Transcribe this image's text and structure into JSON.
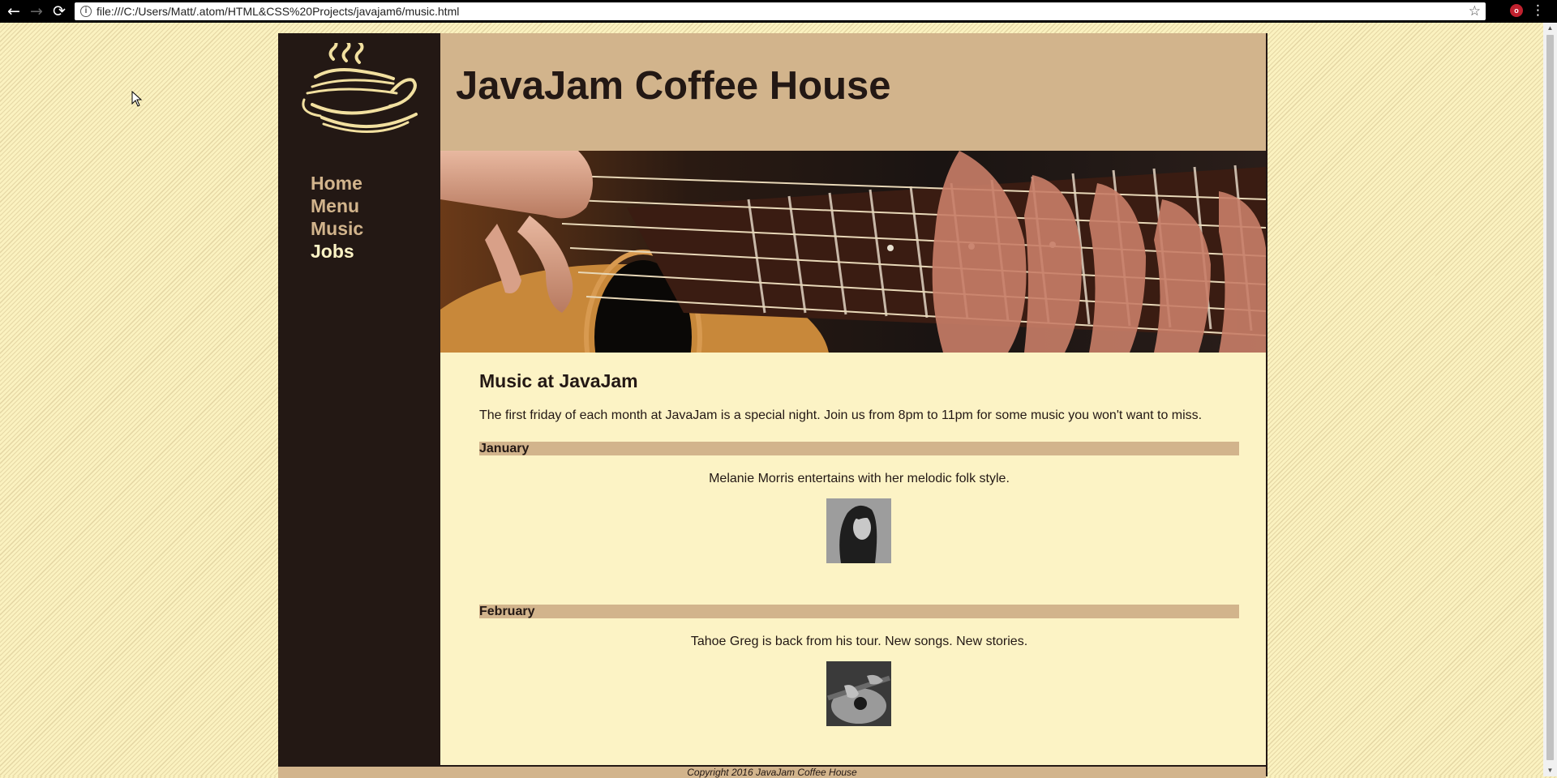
{
  "browser": {
    "url": "file:///C:/Users/Matt/.atom/HTML&CSS%20Projects/javajam6/music.html",
    "back_icon": "←",
    "forward_icon": "→",
    "reload_icon": "⟳",
    "info_icon": "i",
    "star_icon": "☆",
    "menu_icon": "⋮",
    "extension_badge": "o"
  },
  "header": {
    "title": "JavaJam Coffee House"
  },
  "nav": {
    "items": [
      {
        "label": "Home"
      },
      {
        "label": "Menu"
      },
      {
        "label": "Music"
      },
      {
        "label": "Jobs"
      }
    ]
  },
  "main": {
    "heading": "Music at JavaJam",
    "intro": "The first friday of each month at JavaJam is a special night. Join us from 8pm to 11pm for some music you won't want to miss.",
    "events": [
      {
        "month": "January",
        "description": "Melanie Morris entertains with her melodic folk style."
      },
      {
        "month": "February",
        "description": "Tahoe Greg is back from his tour. New songs. New stories."
      }
    ]
  },
  "footer": {
    "text": "Copyright 2016 JavaJam Coffee House"
  },
  "colors": {
    "dark_brown": "#231814",
    "tan": "#d2b48c",
    "cream": "#fcf3c5",
    "logo_gold": "#f2e0a0"
  }
}
